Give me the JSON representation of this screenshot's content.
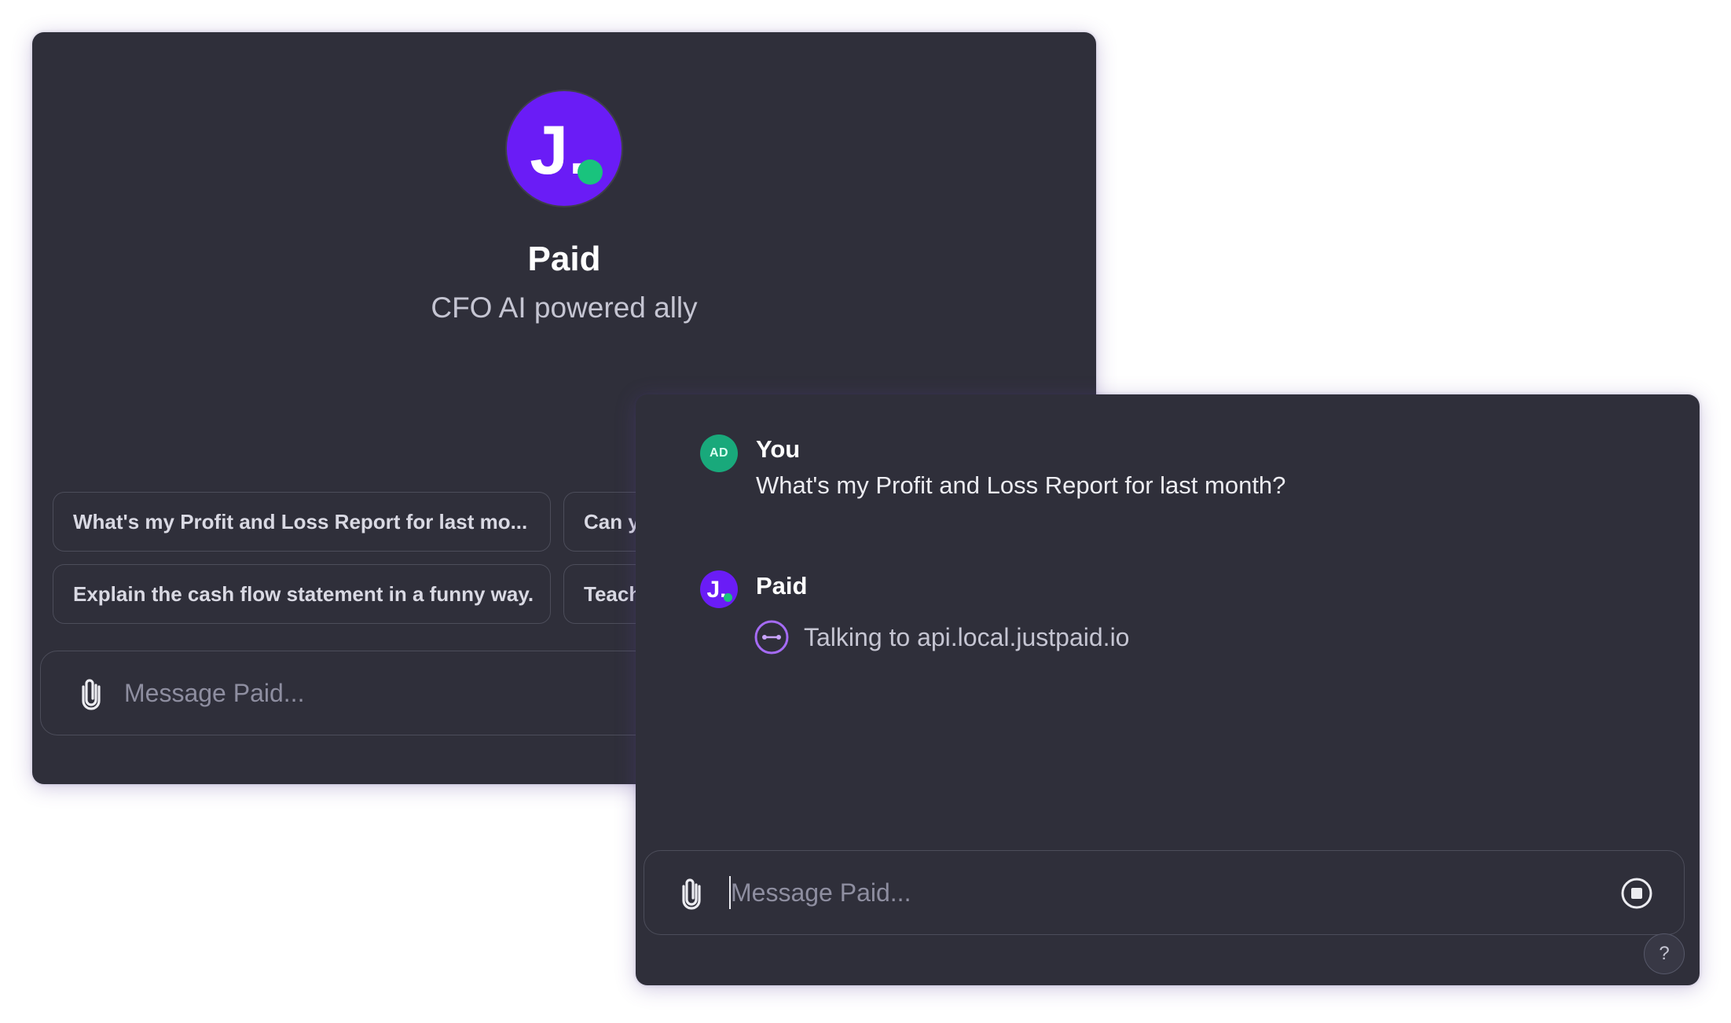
{
  "app": {
    "name": "Paid",
    "tagline": "CFO AI powered ally",
    "avatar_letter": "J.",
    "brand_color": "#6a1cf6",
    "accent_color": "#19c37d"
  },
  "suggestions": [
    "What's my Profit and Loss Report for last mo...",
    "Can y",
    "Explain the cash flow statement in a funny way.",
    "Teach"
  ],
  "composer": {
    "placeholder": "Message Paid...",
    "attach_icon": "paperclip-icon",
    "stop_icon": "stop-icon"
  },
  "conversation": [
    {
      "role": "user",
      "name": "You",
      "avatar_initials": "AD",
      "text": "What's my Profit and Loss Report for last month?"
    },
    {
      "role": "assistant",
      "name": "Paid",
      "avatar_letter": "J.",
      "tool_status": "Talking to api.local.justpaid.io",
      "tool_icon": "plugin-connect-icon"
    }
  ],
  "help": {
    "label": "?"
  }
}
